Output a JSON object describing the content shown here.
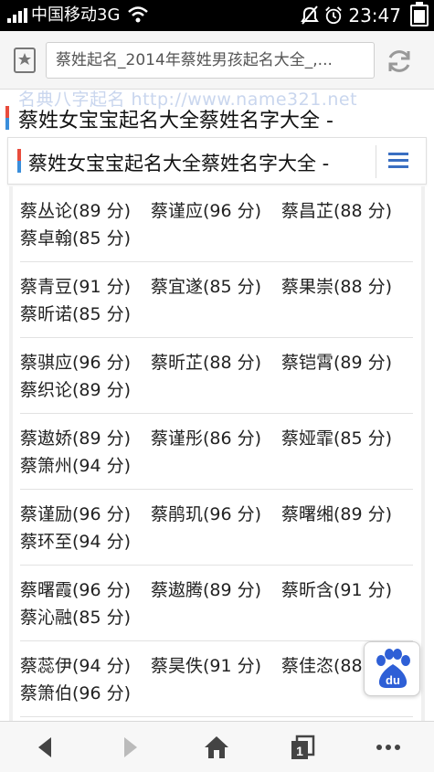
{
  "status_bar": {
    "carrier": "中国移动3G",
    "time": "23:47"
  },
  "browser": {
    "url_text": "蔡姓起名_2014年蔡姓男孩起名大全_,..."
  },
  "watermark": "名典八字起名 http://www.name321.net",
  "page": {
    "title": "蔡姓女宝宝起名大全蔡姓名字大全  -"
  },
  "header_card": {
    "title": "蔡姓女宝宝起名大全蔡姓名字大全  -"
  },
  "name_groups": [
    [
      "蔡丛论(89 分)",
      "蔡谨应(96 分)",
      "蔡昌芷(88 分)",
      "蔡卓翰(85 分)"
    ],
    [
      "蔡青豆(91 分)",
      "蔡宜遂(85 分)",
      "蔡果崇(88 分)",
      "蔡昕诺(85 分)"
    ],
    [
      "蔡骐应(96 分)",
      "蔡昕芷(88 分)",
      "蔡铠霄(89 分)",
      "蔡织论(89 分)"
    ],
    [
      "蔡遨娇(89 分)",
      "蔡谨彤(86 分)",
      "蔡娅霏(85 分)",
      "蔡箫州(94 分)"
    ],
    [
      "蔡谨励(96 分)",
      "蔡鹃玑(96 分)",
      "蔡曙缃(89 分)",
      "蔡环至(94 分)"
    ],
    [
      "蔡曙霞(96 分)",
      "蔡遨腾(89 分)",
      "蔡昕含(91 分)",
      "蔡沁融(85 分)"
    ],
    [
      "蔡蕊伊(94 分)",
      "蔡昊佚(91 分)",
      "蔡佳恣(88 分)",
      "蔡箫伯(96 分)"
    ]
  ],
  "baidu_button": {
    "label": "du",
    "icon": "baidu-paw-icon"
  },
  "colors": {
    "accent_red": "#e84c3d",
    "accent_blue": "#3a8edb",
    "menu_blue": "#3a6fc2",
    "baidu_blue": "#2e5fd6",
    "baidu_red": "#e4312b"
  }
}
